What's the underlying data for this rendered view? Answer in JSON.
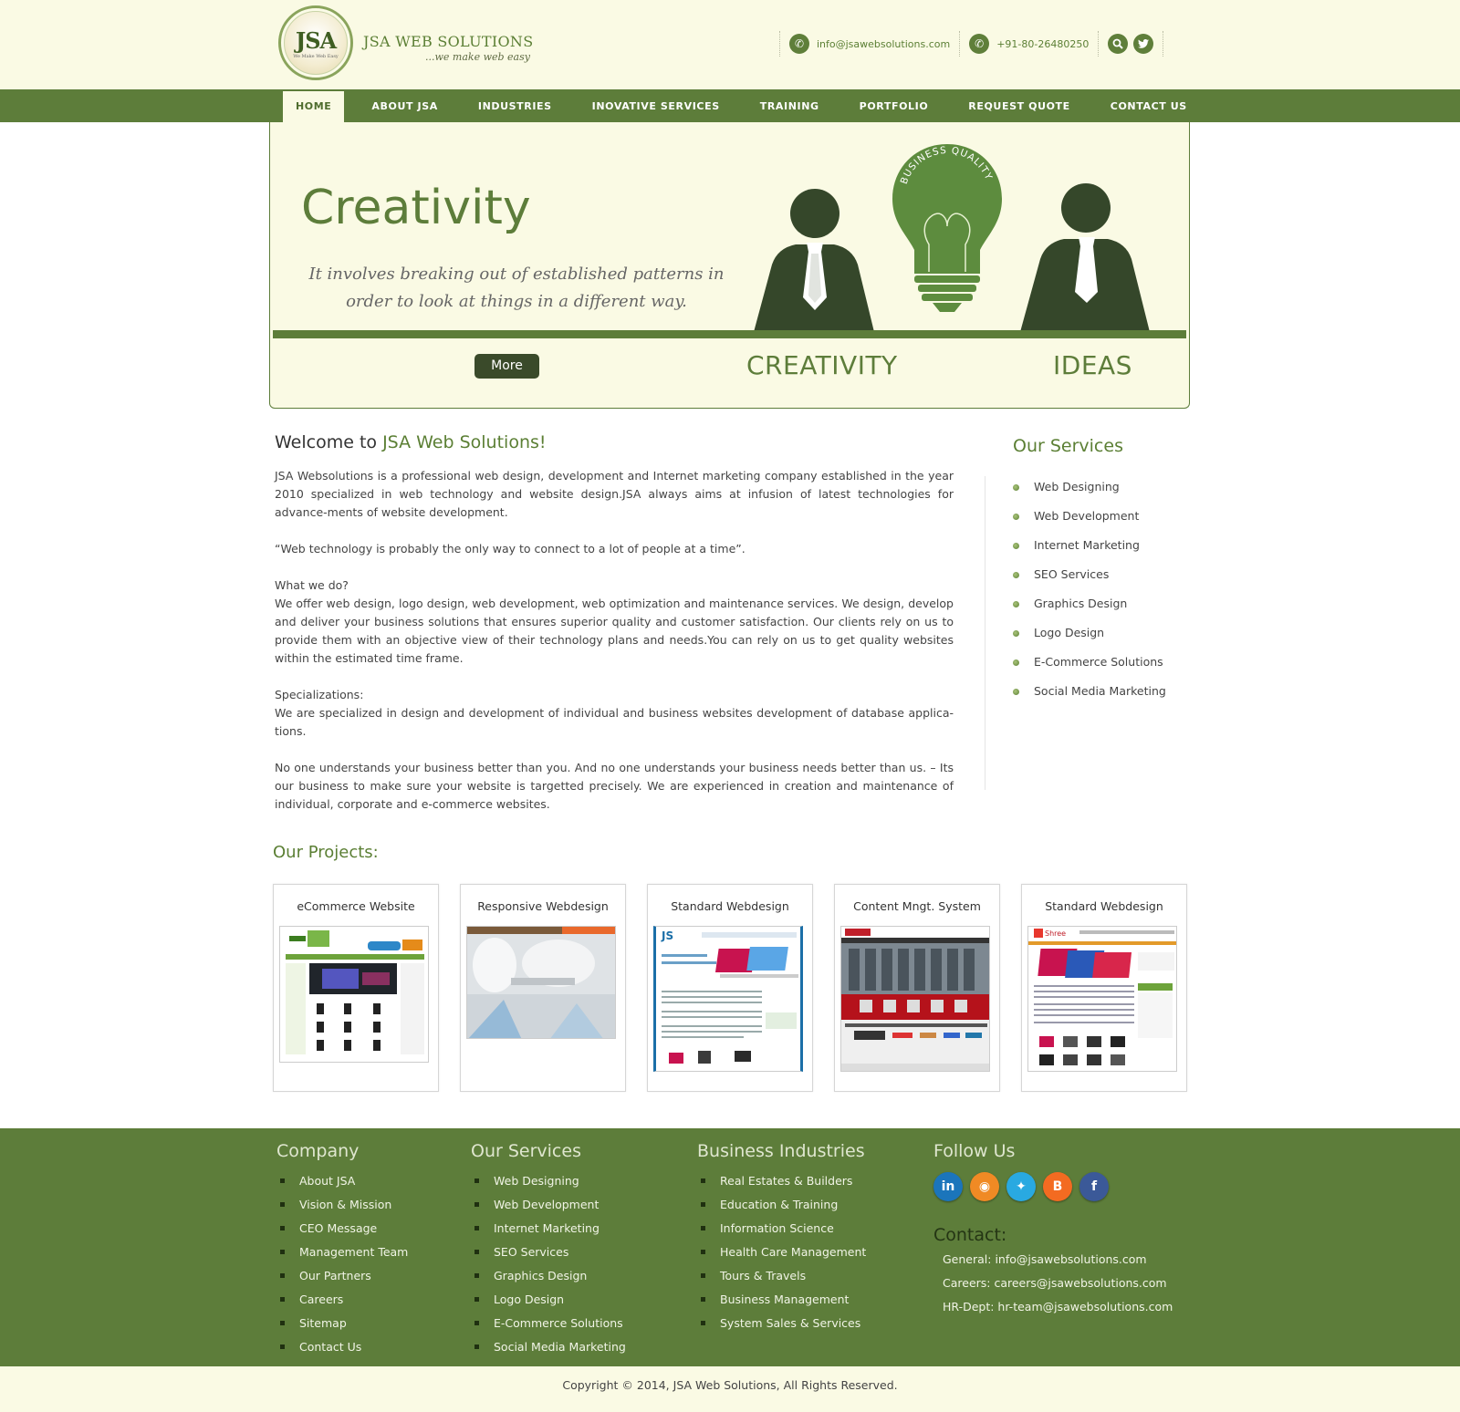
{
  "header": {
    "logo_text": "JSA",
    "logo_small": "We Make Web Easy",
    "brand": "JSA WEB SOLUTIONS",
    "tagline": "...we make web easy",
    "email": "info@jsawebsolutions.com",
    "phone": "+91-80-26480250"
  },
  "nav": [
    "HOME",
    "ABOUT JSA",
    "INDUSTRIES",
    "INOVATIVE SERVICES",
    "TRAINING",
    "PORTFOLIO",
    "REQUEST QUOTE",
    "CONTACT US"
  ],
  "banner": {
    "title": "Creativity",
    "subtitle": "It involves breaking out of established patterns in order to look at things in a different way.",
    "more": "More",
    "word1": "CREATIVITY",
    "word2": "IDEAS",
    "bulb_text": "BUSINESS QUALITY"
  },
  "welcome": {
    "prefix": "Welcome to ",
    "accent": "JSA Web Solutions!"
  },
  "intro": [
    "JSA Websolutions is a professional web design, development and Internet marketing company established in the year 2010 specialized in web technology and website design.JSA always aims at infusion of latest technologies for advance-ments of website development.",
    "“Web technology is probably the only way to connect to a lot of people at a time”.",
    "What we do?\nWe offer web design, logo design, web development, web optimization and maintenance services. We design, develop and deliver your business solutions that ensures superior quality and customer satisfaction. Our clients rely on us to provide them with an objective view of their technology plans and needs.You can rely on us to get quality websites within the estimated time frame.",
    "Specializations:\nWe are specialized in design and development of individual and business websites development of database applica-tions.",
    "No one understands your business better than you. And no one understands your business needs better than us. – Its our business to make sure your website is targetted precisely. We are experienced in creation and maintenance of individual, corporate and e-commerce websites."
  ],
  "services": {
    "title": "Our Services",
    "items": [
      "Web Designing",
      "Web Development",
      "Internet Marketing",
      "SEO Services",
      "Graphics Design",
      "Logo Design",
      "E-Commerce Solutions",
      "Social Media Marketing"
    ]
  },
  "projects": {
    "title": "Our Projects:",
    "items": [
      "eCommerce Website",
      "Responsive Webdesign",
      "Standard Webdesign",
      "Content Mngt. System",
      "Standard Webdesign"
    ]
  },
  "footer": {
    "company": {
      "title": "Company",
      "items": [
        "About JSA",
        "Vision & Mission",
        "CEO Message",
        "Management Team",
        "Our Partners",
        "Careers",
        "Sitemap",
        "Contact Us"
      ]
    },
    "services": {
      "title": "Our Services",
      "items": [
        "Web Designing",
        "Web Development",
        "Internet Marketing",
        "SEO Services",
        "Graphics Design",
        "Logo Design",
        "E-Commerce Solutions",
        "Social Media Marketing"
      ]
    },
    "industries": {
      "title": "Business Industries",
      "items": [
        "Real Estates & Builders",
        "Education & Training",
        "Information Science",
        "Health Care Management",
        "Tours & Travels",
        "Business Management",
        "System Sales & Services"
      ]
    },
    "follow": {
      "title": "Follow Us",
      "icons": [
        "linkedin-icon",
        "rss-icon",
        "twitter-icon",
        "blogger-icon",
        "facebook-icon"
      ],
      "linkedin_glyph": "in",
      "rss_glyph": "◉",
      "twitter_glyph": "✦",
      "blogger_glyph": "B",
      "facebook_glyph": "f"
    },
    "contact": {
      "title": "Contact:",
      "general": "General: info@jsawebsolutions.com",
      "careers": "Careers: careers@jsawebsolutions.com",
      "hr": "HR-Dept: hr-team@jsawebsolutions.com"
    },
    "copyright": "Copyright © 2014, JSA Web Solutions, All Rights Reserved."
  },
  "colors": {
    "brand_green": "#5d7d3a",
    "cream": "#fafae4",
    "dark_figure": "#35472a"
  }
}
